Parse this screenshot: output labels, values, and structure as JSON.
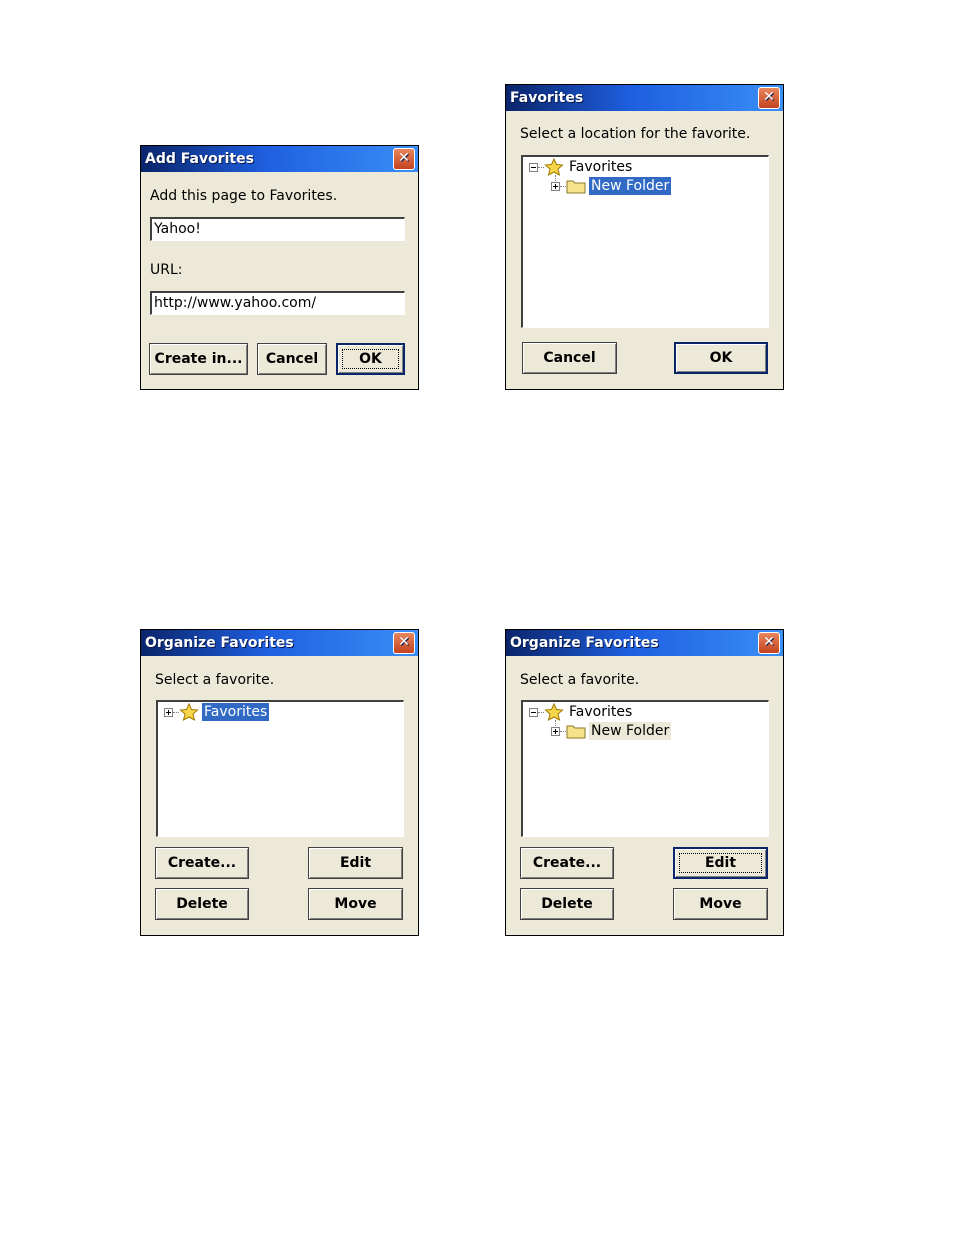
{
  "dialogs": {
    "add_favorites": {
      "title": "Add Favorites",
      "close_glyph": "✕",
      "prompt": "Add this page to Favorites.",
      "name_value": "Yahoo!",
      "url_label": "URL:",
      "url_value": "http://www.yahoo.com/",
      "buttons": {
        "create_in": "Create in...",
        "cancel": "Cancel",
        "ok": "OK"
      }
    },
    "favorites_location": {
      "title": "Favorites",
      "close_glyph": "✕",
      "prompt": "Select a location for the favorite.",
      "tree": {
        "root": "Favorites",
        "child": "New Folder"
      },
      "buttons": {
        "cancel": "Cancel",
        "ok": "OK"
      }
    },
    "organize_1": {
      "title": "Organize Favorites",
      "close_glyph": "✕",
      "prompt": "Select a favorite.",
      "tree": {
        "root": "Favorites"
      },
      "buttons": {
        "create": "Create...",
        "edit": "Edit",
        "delete": "Delete",
        "move": "Move"
      }
    },
    "organize_2": {
      "title": "Organize Favorites",
      "close_glyph": "✕",
      "prompt": "Select a favorite.",
      "tree": {
        "root": "Favorites",
        "child": "New Folder"
      },
      "buttons": {
        "create": "Create...",
        "edit": "Edit",
        "delete": "Delete",
        "move": "Move"
      }
    }
  },
  "icons": {
    "star": "star-icon",
    "folder": "folder-icon",
    "expander": "plus-minus-box"
  },
  "colors": {
    "title_start": "#0A246A",
    "title_end": "#3A8EF7",
    "dialog_bg": "#ECE9D8",
    "selection": "#316AC5",
    "close": "#C2421F"
  }
}
